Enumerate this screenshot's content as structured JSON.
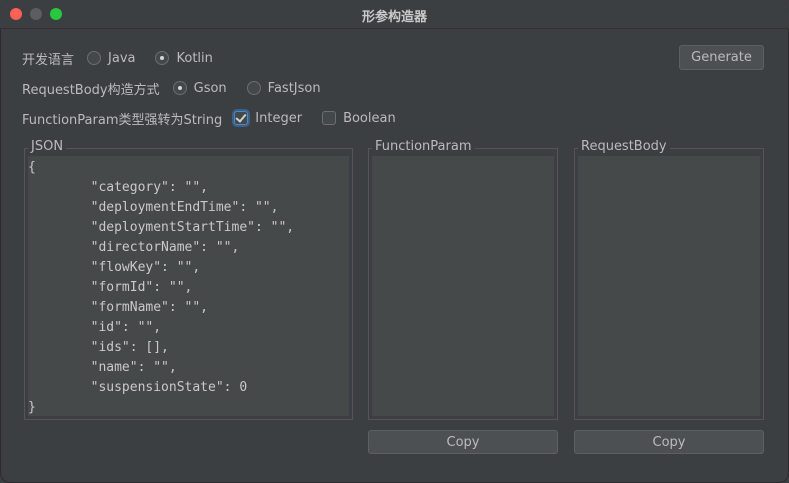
{
  "window": {
    "title": "形参构造器"
  },
  "language": {
    "label": "开发语言",
    "options": [
      {
        "label": "Java",
        "selected": false
      },
      {
        "label": "Kotlin",
        "selected": true
      }
    ]
  },
  "request_body": {
    "label": "RequestBody构造方式",
    "options": [
      {
        "label": "Gson",
        "selected": true
      },
      {
        "label": "FastJson",
        "selected": false
      }
    ]
  },
  "function_param": {
    "label": "FunctionParam类型强转为String",
    "checks": [
      {
        "label": "Integer",
        "checked": true
      },
      {
        "label": "Boolean",
        "checked": false
      }
    ]
  },
  "buttons": {
    "generate": "Generate",
    "copy_function_param": "Copy",
    "copy_request_body": "Copy"
  },
  "panels": {
    "json": {
      "title": "JSON",
      "content": "{\n        \"category\": \"\",\n        \"deploymentEndTime\": \"\",\n        \"deploymentStartTime\": \"\",\n        \"directorName\": \"\",\n        \"flowKey\": \"\",\n        \"formId\": \"\",\n        \"formName\": \"\",\n        \"id\": \"\",\n        \"ids\": [],\n        \"name\": \"\",\n        \"suspensionState\": 0\n}"
    },
    "function_param": {
      "title": "FunctionParam",
      "content": ""
    },
    "request_body": {
      "title": "RequestBody",
      "content": ""
    }
  },
  "colors": {
    "background": "#3c3f41",
    "text_area": "#45494a",
    "close": "#fe5f57",
    "maximize": "#28c840",
    "check_focus": "#4a88c7"
  }
}
